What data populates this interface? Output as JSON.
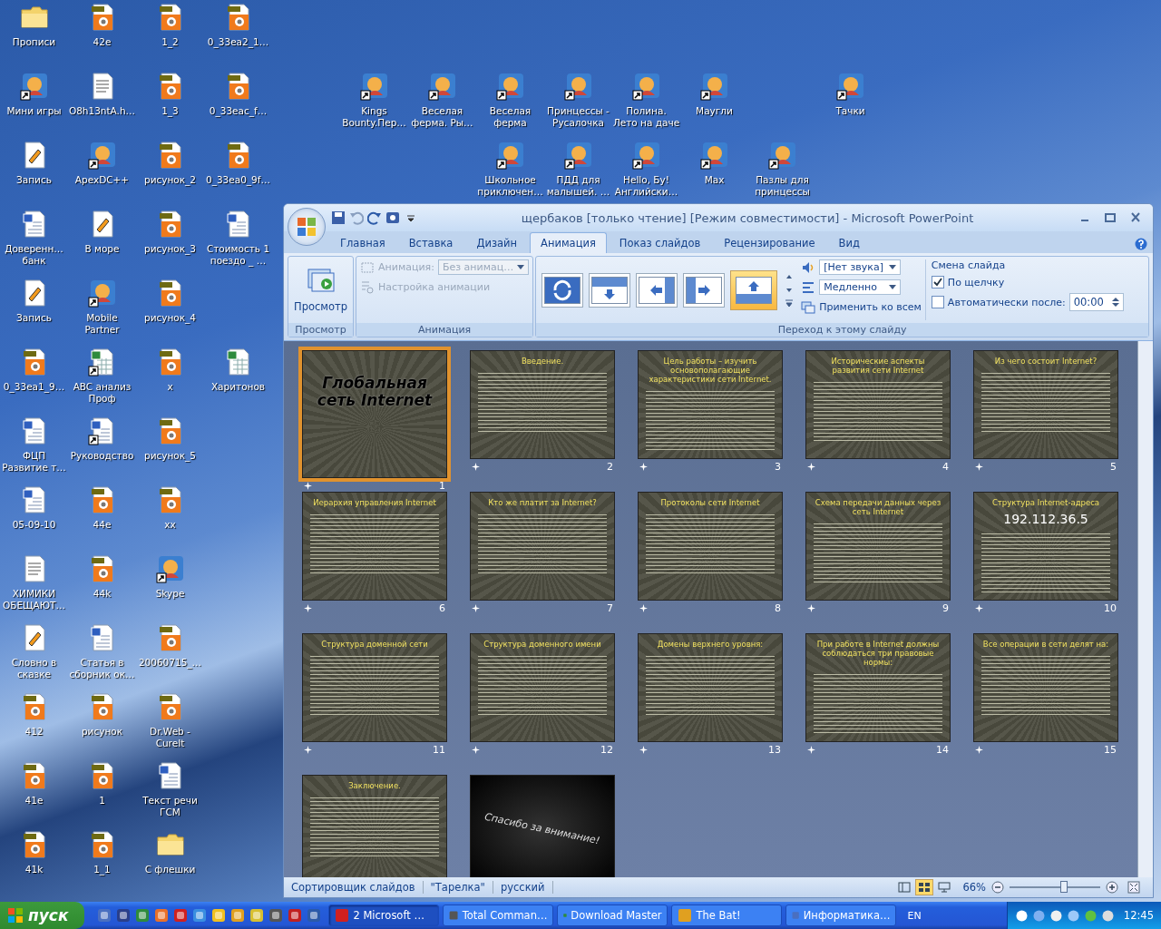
{
  "desktop_columns": [
    [
      {
        "label": "Прописи",
        "kind": "folder",
        "shortcut": false
      },
      {
        "label": "Мини игры",
        "kind": "app",
        "shortcut": true
      },
      {
        "label": "Запись",
        "kind": "media",
        "shortcut": false
      },
      {
        "label": "Доверенн… банк",
        "kind": "word",
        "shortcut": false
      },
      {
        "label": "Запись",
        "kind": "media",
        "shortcut": false
      },
      {
        "label": "0_33ea1_9…",
        "kind": "jpg",
        "shortcut": false
      },
      {
        "label": "ФЦП Развитие т…",
        "kind": "word",
        "shortcut": false
      },
      {
        "label": "05-09-10",
        "kind": "word",
        "shortcut": false
      },
      {
        "label": "ХИМИКИ ОБЕЩАЮТ…",
        "kind": "text",
        "shortcut": false
      },
      {
        "label": "Словно в сказке",
        "kind": "media",
        "shortcut": false
      },
      {
        "label": "412",
        "kind": "jpg",
        "shortcut": false
      },
      {
        "label": "41e",
        "kind": "jpg",
        "shortcut": false
      },
      {
        "label": "41k",
        "kind": "jpg",
        "shortcut": false
      }
    ],
    [
      {
        "label": "42e",
        "kind": "jpg",
        "shortcut": false
      },
      {
        "label": "O8h13ntA.h…",
        "kind": "text",
        "shortcut": false
      },
      {
        "label": "ApexDC++",
        "kind": "app",
        "shortcut": true
      },
      {
        "label": "В море",
        "kind": "media",
        "shortcut": false
      },
      {
        "label": "Mobile Partner",
        "kind": "app",
        "shortcut": true
      },
      {
        "label": "ABC анализ Проф",
        "kind": "excel",
        "shortcut": true
      },
      {
        "label": "Руководство",
        "kind": "word",
        "shortcut": true
      },
      {
        "label": "44e",
        "kind": "jpg",
        "shortcut": false
      },
      {
        "label": "44k",
        "kind": "jpg",
        "shortcut": false
      },
      {
        "label": "Статья в сборник ок…",
        "kind": "word",
        "shortcut": false
      },
      {
        "label": "рисунок",
        "kind": "jpg",
        "shortcut": false
      },
      {
        "label": "1",
        "kind": "jpg",
        "shortcut": false
      },
      {
        "label": "1_1",
        "kind": "jpg",
        "shortcut": false
      }
    ],
    [
      {
        "label": "1_2",
        "kind": "jpg",
        "shortcut": false
      },
      {
        "label": "1_3",
        "kind": "jpg",
        "shortcut": false
      },
      {
        "label": "рисунок_2",
        "kind": "jpg",
        "shortcut": false
      },
      {
        "label": "рисунок_3",
        "kind": "jpg",
        "shortcut": false
      },
      {
        "label": "рисунок_4",
        "kind": "jpg",
        "shortcut": false
      },
      {
        "label": "x",
        "kind": "jpg",
        "shortcut": false
      },
      {
        "label": "рисунок_5",
        "kind": "jpg",
        "shortcut": false
      },
      {
        "label": "xx",
        "kind": "jpg",
        "shortcut": false
      },
      {
        "label": "Skype",
        "kind": "app",
        "shortcut": true
      },
      {
        "label": "20060715_…",
        "kind": "jpg",
        "shortcut": false
      },
      {
        "label": "Dr.Web - CureIt",
        "kind": "jpg",
        "shortcut": false
      },
      {
        "label": "Текст речи ГСМ",
        "kind": "word",
        "shortcut": false
      },
      {
        "label": "С флешки",
        "kind": "folder",
        "shortcut": false
      }
    ],
    [
      {
        "label": "0_33ea2_1…",
        "kind": "jpg",
        "shortcut": false
      },
      {
        "label": "0_33eac_f…",
        "kind": "jpg",
        "shortcut": false
      },
      {
        "label": "0_33ea0_9f…",
        "kind": "jpg",
        "shortcut": false
      },
      {
        "label": "Стоимость 1 поездо _ …",
        "kind": "word",
        "shortcut": false
      },
      null,
      {
        "label": "Харитонов",
        "kind": "excel",
        "shortcut": false
      }
    ],
    [],
    [
      null,
      {
        "label": "Kings Bounty.Пер…",
        "kind": "app",
        "shortcut": true
      }
    ],
    [
      null,
      {
        "label": "Веселая ферма. Ры…",
        "kind": "app",
        "shortcut": true
      }
    ],
    [
      null,
      {
        "label": "Веселая ферма",
        "kind": "app",
        "shortcut": true
      },
      {
        "label": "Школьное приключен…",
        "kind": "app",
        "shortcut": true
      }
    ],
    [
      null,
      {
        "label": "Принцессы - Русалочка",
        "kind": "app",
        "shortcut": true
      },
      {
        "label": "ПДД для малышей. …",
        "kind": "app",
        "shortcut": true
      }
    ],
    [
      null,
      {
        "label": "Полина. Лето на даче",
        "kind": "app",
        "shortcut": true
      },
      {
        "label": "Hello, Бу! Английски…",
        "kind": "app",
        "shortcut": true
      }
    ],
    [
      null,
      {
        "label": "Маугли",
        "kind": "app",
        "shortcut": true
      },
      {
        "label": "Max",
        "kind": "app",
        "shortcut": true
      }
    ],
    [
      null,
      null,
      {
        "label": "Пазлы для принцессы",
        "kind": "app",
        "shortcut": true
      }
    ],
    [
      null,
      {
        "label": "Тачки",
        "kind": "app",
        "shortcut": true
      }
    ]
  ],
  "window": {
    "title": "щербаков [только чтение] [Режим совместимости] - Microsoft PowerPoint"
  },
  "tabs": [
    {
      "label": "Главная",
      "selected": false
    },
    {
      "label": "Вставка",
      "selected": false
    },
    {
      "label": "Дизайн",
      "selected": false
    },
    {
      "label": "Анимация",
      "selected": true
    },
    {
      "label": "Показ слайдов",
      "selected": false
    },
    {
      "label": "Рецензирование",
      "selected": false
    },
    {
      "label": "Вид",
      "selected": false
    }
  ],
  "ribbon": {
    "preview_group": {
      "button": "Просмотр",
      "caption": "Просмотр"
    },
    "animation_group": {
      "label": "Анимация:",
      "value": "Без анимац…",
      "custom": "Настройка анимации",
      "disabled": true,
      "caption": "Анимация"
    },
    "transition_group": {
      "caption": "Переход к этому слайду",
      "transitions": [
        {
          "selected": false
        },
        {
          "selected": false
        },
        {
          "selected": false
        },
        {
          "selected": false
        },
        {
          "selected": true
        }
      ],
      "sound": "[Нет звука]",
      "speed": "Медленно",
      "apply_all": "Применить ко всем"
    },
    "advance": {
      "title": "Смена слайда",
      "on_click": {
        "label": "По щелчку",
        "checked": true
      },
      "after": {
        "label": "Автоматически после:",
        "checked": false,
        "value": "00:00"
      }
    }
  },
  "slides": [
    {
      "number": "1",
      "kind": "title",
      "title": "Глобальная сеть Internet",
      "selected": true
    },
    {
      "number": "2",
      "kind": "content",
      "title": "Введение.",
      "selected": false
    },
    {
      "number": "3",
      "kind": "content",
      "title": "Цель работы – изучить основополагающие характеристики сети Internet.",
      "selected": false
    },
    {
      "number": "4",
      "kind": "content",
      "title": "Исторические аспекты развития сети Internet",
      "selected": false
    },
    {
      "number": "5",
      "kind": "content",
      "title": "Из чего состоит Internet?",
      "selected": false
    },
    {
      "number": "6",
      "kind": "content",
      "title": "Иерархия управления Internet",
      "selected": false
    },
    {
      "number": "7",
      "kind": "content",
      "title": "Кто же платит за Internet?",
      "selected": false
    },
    {
      "number": "8",
      "kind": "content",
      "title": "Протоколы сети Internet",
      "selected": false
    },
    {
      "number": "9",
      "kind": "content",
      "title": "Схема передачи данных через сеть Internet",
      "selected": false
    },
    {
      "number": "10",
      "kind": "content",
      "title": "Структура Internet-адреса",
      "extra": "192.112.36.5",
      "selected": false
    },
    {
      "number": "11",
      "kind": "content",
      "title": "Структура доменной сети",
      "selected": false
    },
    {
      "number": "12",
      "kind": "content",
      "title": "Структура доменного имени",
      "selected": false
    },
    {
      "number": "13",
      "kind": "content",
      "title": "Домены верхнего уровня:",
      "selected": false
    },
    {
      "number": "14",
      "kind": "content",
      "title": "При работе в Internet должны соблюдаться три правовые нормы:",
      "selected": false
    },
    {
      "number": "15",
      "kind": "content",
      "title": "Все операции в сети делят на:",
      "selected": false
    },
    {
      "kind": "content",
      "title": "Заключение.",
      "selected": false
    },
    {
      "kind": "closing",
      "title": "Спасибо за внимание!",
      "selected": false
    }
  ],
  "status_bar": {
    "view": "Сортировщик слайдов",
    "theme": "\"Тарелка\"",
    "language": "русский",
    "views": [
      {
        "selected": false
      },
      {
        "selected": true
      },
      {
        "selected": false
      }
    ],
    "zoom": "66%",
    "zoom_level": {
      "level": 0.6
    }
  },
  "taskbar": {
    "start": "пуск",
    "tasks": [
      {
        "label": "2 Microsoft …",
        "selected": true
      },
      {
        "label": "Total Comman…",
        "selected": false
      },
      {
        "label": "Download Master",
        "selected": false
      },
      {
        "label": "The Bat!",
        "selected": false
      },
      {
        "label": "Информатика…",
        "selected": false
      }
    ],
    "language": "EN",
    "time": "12:45"
  }
}
